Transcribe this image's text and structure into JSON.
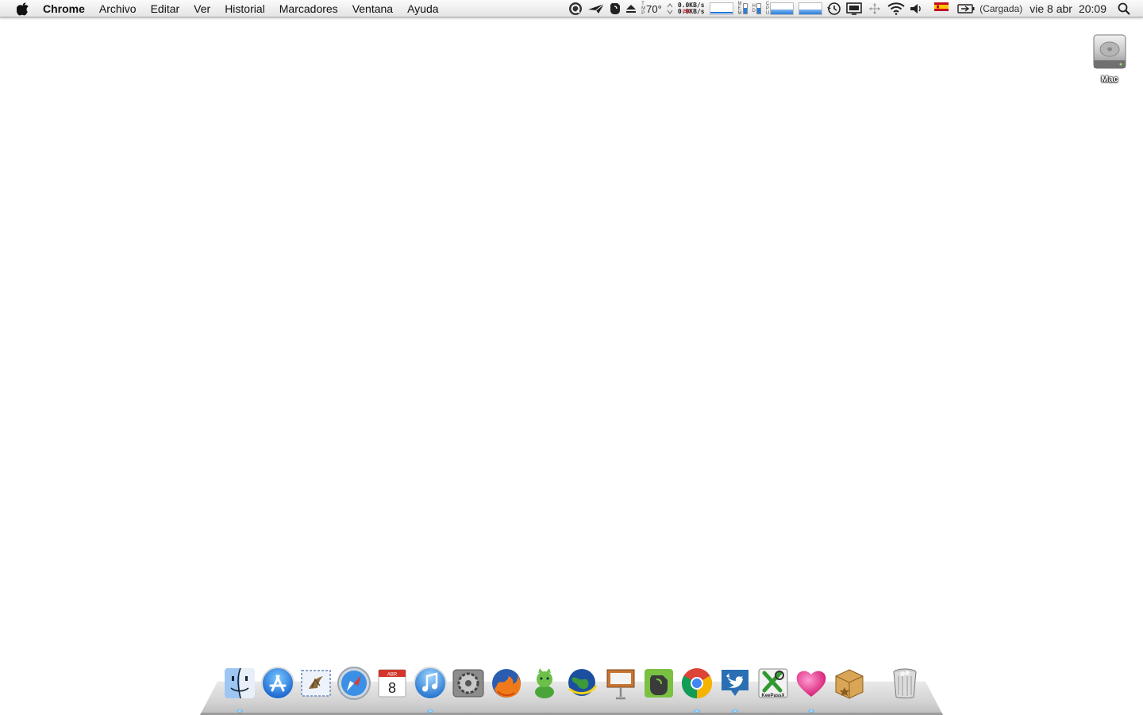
{
  "menubar": {
    "app_name": "Chrome",
    "menus": [
      "Archivo",
      "Editar",
      "Ver",
      "Historial",
      "Marcadores",
      "Ventana",
      "Ayuda"
    ],
    "status": {
      "temperature": "70°",
      "net_up": "0.0KB/s",
      "net_down": "0.0KB/s",
      "tmp_label": [
        "T",
        "M",
        "P"
      ],
      "mem_label": [
        "M",
        "E",
        "M"
      ],
      "hd_label": [
        "H",
        "D"
      ],
      "cpu_label": [
        "C",
        "P",
        "U"
      ],
      "battery_status": "(Cargada)",
      "date": "vie 8 abr",
      "time": "20:09",
      "input_source": "ISO",
      "mem_level": 0.6,
      "hd_level": 0.55
    }
  },
  "desktop": {
    "volume_label": "Mac"
  },
  "dock": {
    "apps": [
      {
        "name": "Finder",
        "icon": "finder-icon",
        "running": true
      },
      {
        "name": "App Store",
        "icon": "appstore-icon",
        "running": false
      },
      {
        "name": "Mail",
        "icon": "mail-icon",
        "running": false
      },
      {
        "name": "Safari",
        "icon": "safari-icon",
        "running": false
      },
      {
        "name": "iCal",
        "icon": "calendar-icon",
        "running": false,
        "calendar_month": "ABR",
        "calendar_day": "8"
      },
      {
        "name": "iTunes",
        "icon": "itunes-icon",
        "running": true
      },
      {
        "name": "System Preferences",
        "icon": "system-preferences-icon",
        "running": false
      },
      {
        "name": "Firefox",
        "icon": "firefox-icon",
        "running": false
      },
      {
        "name": "Adium",
        "icon": "adium-icon",
        "running": false
      },
      {
        "name": "Google Earth",
        "icon": "google-earth-icon",
        "running": false
      },
      {
        "name": "Keynote",
        "icon": "keynote-icon",
        "running": false
      },
      {
        "name": "Evernote",
        "icon": "evernote-icon",
        "running": false
      },
      {
        "name": "Chrome",
        "icon": "chrome-icon",
        "running": true
      },
      {
        "name": "Twitter",
        "icon": "twitter-icon",
        "running": true
      },
      {
        "name": "KeePassX",
        "icon": "keepassx-icon",
        "running": false,
        "icon_text": "KeePassX"
      },
      {
        "name": "Heart app",
        "icon": "heart-icon",
        "running": true
      },
      {
        "name": "Package",
        "icon": "package-icon",
        "running": false
      }
    ],
    "trash": {
      "name": "Trash",
      "icon": "trash-icon"
    }
  },
  "colors": {
    "accent": "#2a7fdb",
    "flag_red": "#c60b1e",
    "flag_yellow": "#ffc400"
  }
}
